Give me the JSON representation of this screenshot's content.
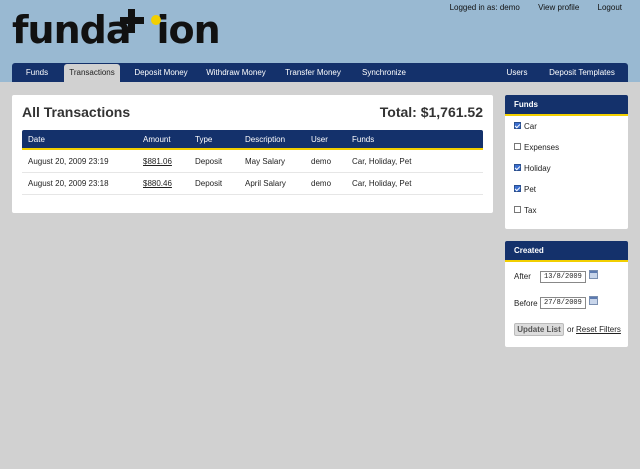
{
  "brand": {
    "logo_text": "funda",
    "logo_tail": "ion",
    "accent": "#f2cf00",
    "nav_blue": "#14316b"
  },
  "userbar": {
    "logged_in": "Logged in as: demo",
    "view_profile": "View profile",
    "logout": "Logout"
  },
  "nav": {
    "funds": "Funds",
    "transactions": "Transactions",
    "deposit": "Deposit Money",
    "withdraw": "Withdraw Money",
    "transfer": "Transfer Money",
    "sync": "Synchronize",
    "users": "Users",
    "templates": "Deposit Templates"
  },
  "main": {
    "title": "All Transactions",
    "total": "Total: $1,761.52",
    "columns": {
      "date": "Date",
      "amount": "Amount",
      "type": "Type",
      "description": "Description",
      "user": "User",
      "funds": "Funds"
    },
    "rows": [
      {
        "date": "August 20, 2009 23:19",
        "amount": "$881.06",
        "type": "Deposit",
        "description": "May Salary",
        "user": "demo",
        "funds": "Car, Holiday, Pet"
      },
      {
        "date": "August 20, 2009 23:18",
        "amount": "$880.46",
        "type": "Deposit",
        "description": "April Salary",
        "user": "demo",
        "funds": "Car, Holiday, Pet"
      }
    ]
  },
  "funds_filter": {
    "title": "Funds",
    "items": [
      {
        "label": "Car",
        "checked": true
      },
      {
        "label": "Expenses",
        "checked": false
      },
      {
        "label": "Holiday",
        "checked": true
      },
      {
        "label": "Pet",
        "checked": true
      },
      {
        "label": "Tax",
        "checked": false
      }
    ]
  },
  "created_filter": {
    "title": "Created",
    "after_label": "After",
    "after_value": "13/8/2009",
    "before_label": "Before",
    "before_value": "27/8/2009",
    "update_label": "Update List",
    "or_text": "or",
    "reset_label": "Reset Filters"
  }
}
